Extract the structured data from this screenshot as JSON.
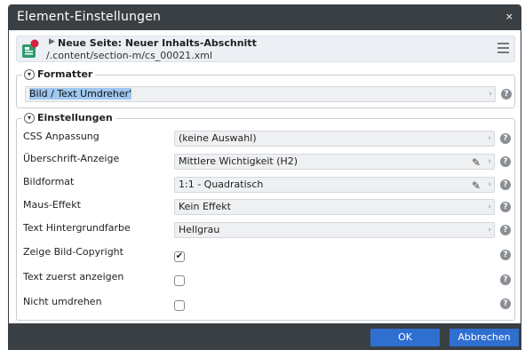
{
  "dialog": {
    "title": "Element-Einstellungen",
    "close_glyph": "×"
  },
  "resource": {
    "icon": "content-element-icon",
    "title": "Neue Seite: Neuer Inhalts-Abschnitt",
    "path": "/.content/section-m/cs_00021.xml"
  },
  "formatter": {
    "legend": "Formatter",
    "value": "Bild / Text Umdreher'"
  },
  "settings": {
    "legend": "Einstellungen",
    "fields": [
      {
        "label": "CSS Anpassung",
        "value": "(keine Auswahl)"
      },
      {
        "label": "Überschrift-Anzeige",
        "value": "Mittlere Wichtigkeit (H2)"
      },
      {
        "label": "Bildformat",
        "value": "1:1 - Quadratisch"
      },
      {
        "label": "Maus-Effekt",
        "value": "Kein Effekt"
      },
      {
        "label": "Text Hintergrundfarbe",
        "value": "Hellgrau"
      }
    ],
    "checkboxes": [
      {
        "label": "Zeige Bild-Copyright",
        "checked": true,
        "mark": "✔"
      },
      {
        "label": "Text zuerst anzeigen",
        "checked": false,
        "mark": ""
      },
      {
        "label": "Nicht umdrehen",
        "checked": false,
        "mark": ""
      }
    ]
  },
  "glyphs": {
    "help": "?",
    "chevron": "›",
    "pencil": "✎",
    "toggle": "▾"
  },
  "buttons": {
    "ok": "OK",
    "cancel": "Abbrechen"
  },
  "colors": {
    "titlebar": "#3a3f44",
    "button": "#2f6fd0",
    "selection": "#9fc7ef"
  }
}
